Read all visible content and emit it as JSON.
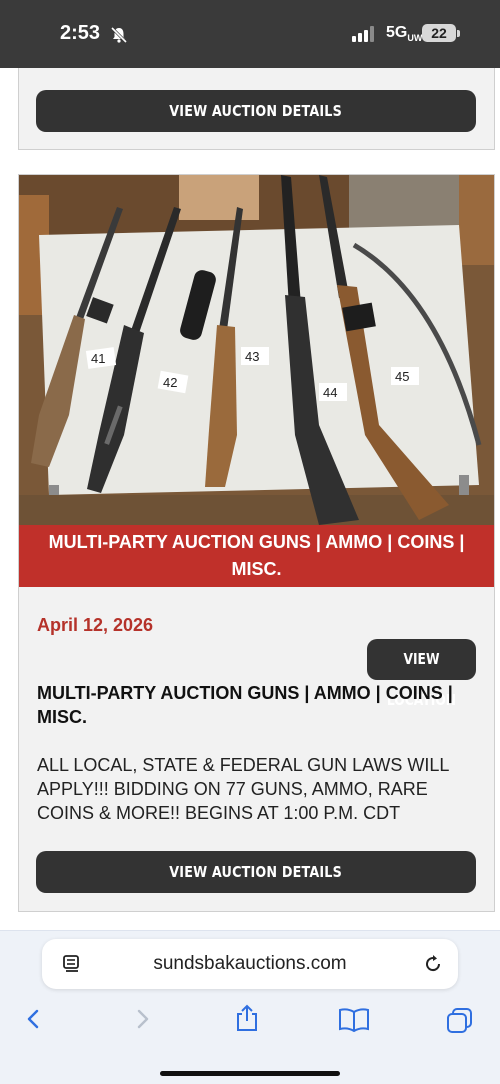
{
  "status_bar": {
    "time": "2:53",
    "network": "5G",
    "network_sub": "UW",
    "battery": "22"
  },
  "previous_card": {
    "details_button": "VIEW AUCTION DETAILS"
  },
  "card": {
    "photo_alt": "Five rifles lying on a white table, tagged 41, 42, 43, 44, 45",
    "photo_tags": [
      "41",
      "42",
      "43",
      "44",
      "45"
    ],
    "banner_title": "MULTI-PARTY AUCTION GUNS | AMMO | COINS | MISC.",
    "date": "April 12, 2026",
    "view_location_button": "VIEW LOCATION",
    "title": "MULTI-PARTY AUCTION GUNS | AMMO | COINS | MISC.",
    "description": "ALL LOCAL, STATE & FEDERAL GUN LAWS WILL APPLY!!! BIDDING ON 77 GUNS, AMMO, RARE COINS & MORE!! BEGINS AT 1:00 P.M. CDT",
    "details_button": "VIEW AUCTION DETAILS"
  },
  "browser": {
    "url": "sundsbakauctions.com"
  },
  "colors": {
    "status_bar": "#3a3a3a",
    "button": "#333333",
    "banner": "#c0302a",
    "date": "#b5322a",
    "toolbar_icon": "#2f6fe0"
  }
}
